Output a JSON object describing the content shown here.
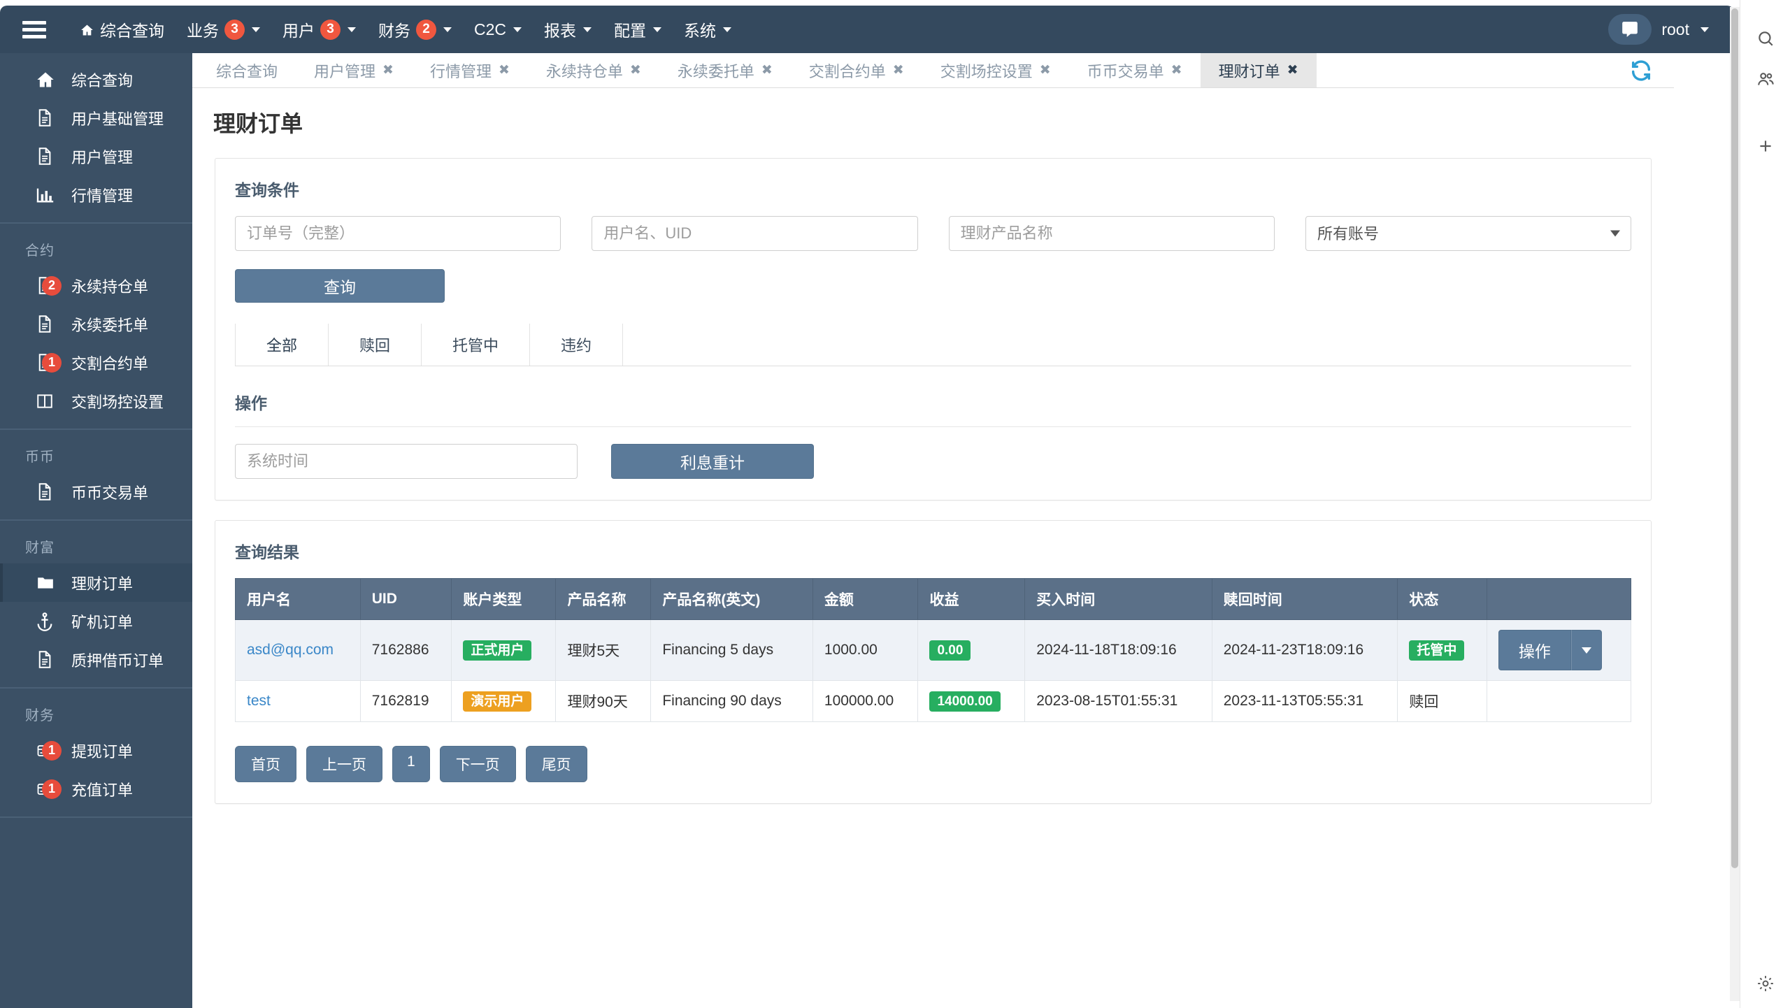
{
  "navbar": {
    "hamburger_icon": "hamburger-icon",
    "items": [
      {
        "label": "综合查询",
        "icon": "home-icon",
        "badge": null,
        "caret": false
      },
      {
        "label": "业务",
        "icon": null,
        "badge": "3",
        "caret": true
      },
      {
        "label": "用户",
        "icon": null,
        "badge": "3",
        "caret": true
      },
      {
        "label": "财务",
        "icon": null,
        "badge": "2",
        "caret": true
      },
      {
        "label": "C2C",
        "icon": null,
        "badge": null,
        "caret": true
      },
      {
        "label": "报表",
        "icon": null,
        "badge": null,
        "caret": true
      },
      {
        "label": "配置",
        "icon": null,
        "badge": null,
        "caret": true
      },
      {
        "label": "系统",
        "icon": null,
        "badge": null,
        "caret": true
      }
    ],
    "chat_icon": "chat-icon",
    "user": "root",
    "accent": "#f0573f",
    "background": "#34495e"
  },
  "sidebar": {
    "background": "#3b5065",
    "groups": [
      {
        "heading": null,
        "items": [
          {
            "label": "综合查询",
            "icon": "home-icon",
            "badge": null,
            "active": false
          },
          {
            "label": "用户基础管理",
            "icon": "document-icon",
            "badge": null,
            "active": false
          },
          {
            "label": "用户管理",
            "icon": "document-icon",
            "badge": null,
            "active": false
          },
          {
            "label": "行情管理",
            "icon": "chart-bar-icon",
            "badge": null,
            "active": false
          }
        ]
      },
      {
        "heading": "合约",
        "items": [
          {
            "label": "永续持仓单",
            "icon": "document-icon",
            "badge": "2",
            "active": false
          },
          {
            "label": "永续委托单",
            "icon": "document-icon",
            "badge": null,
            "active": false
          },
          {
            "label": "交割合约单",
            "icon": "document-icon",
            "badge": "1",
            "active": false
          },
          {
            "label": "交割场控设置",
            "icon": "columns-icon",
            "badge": null,
            "active": false
          }
        ]
      },
      {
        "heading": "币币",
        "items": [
          {
            "label": "币币交易单",
            "icon": "document-icon",
            "badge": null,
            "active": false
          }
        ]
      },
      {
        "heading": "财富",
        "items": [
          {
            "label": "理财订单",
            "icon": "folder-icon",
            "badge": null,
            "active": true
          },
          {
            "label": "矿机订单",
            "icon": "anchor-icon",
            "badge": null,
            "active": false
          },
          {
            "label": "质押借币订单",
            "icon": "document-icon",
            "badge": null,
            "active": false
          }
        ]
      },
      {
        "heading": "财务",
        "items": [
          {
            "label": "提现订单",
            "icon": "card-icon",
            "badge": "1",
            "active": false
          },
          {
            "label": "充值订单",
            "icon": "card-icon",
            "badge": "1",
            "active": false
          }
        ]
      }
    ]
  },
  "tabs": [
    {
      "label": "综合查询",
      "closable": false,
      "active": false
    },
    {
      "label": "用户管理",
      "closable": true,
      "active": false
    },
    {
      "label": "行情管理",
      "closable": true,
      "active": false
    },
    {
      "label": "永续持仓单",
      "closable": true,
      "active": false
    },
    {
      "label": "永续委托单",
      "closable": true,
      "active": false
    },
    {
      "label": "交割合约单",
      "closable": true,
      "active": false
    },
    {
      "label": "交割场控设置",
      "closable": true,
      "active": false
    },
    {
      "label": "币币交易单",
      "closable": true,
      "active": false
    },
    {
      "label": "理财订单",
      "closable": true,
      "active": true
    }
  ],
  "tab_close_glyph": "✖",
  "refresh_icon": "refresh-icon",
  "page": {
    "title": "理财订单"
  },
  "query": {
    "section_title": "查询条件",
    "order_no_placeholder": "订单号（完整）",
    "order_no_value": "",
    "user_placeholder": "用户名、UID",
    "user_value": "",
    "product_placeholder": "理财产品名称",
    "product_value": "",
    "account_selected": "所有账号",
    "account_options": [
      "所有账号"
    ],
    "query_button": "查询"
  },
  "status_tabs": [
    {
      "label": "全部",
      "active": true
    },
    {
      "label": "赎回",
      "active": false
    },
    {
      "label": "托管中",
      "active": false
    },
    {
      "label": "违约",
      "active": false
    }
  ],
  "operation": {
    "section_title": "操作",
    "systime_placeholder": "系统时间",
    "systime_value": "",
    "interest_button": "利息重计"
  },
  "results": {
    "section_title": "查询结果",
    "columns": [
      "用户名",
      "UID",
      "账户类型",
      "产品名称",
      "产品名称(英文)",
      "金额",
      "收益",
      "买入时间",
      "赎回时间",
      "状态",
      ""
    ],
    "rows": [
      {
        "username": "asd@qq.com",
        "uid": "7162886",
        "account_type": "正式用户",
        "account_type_color": "#27ae60",
        "product_name": "理财5天",
        "product_name_en": "Financing 5 days",
        "amount": "1000.00",
        "profit": "0.00",
        "profit_color": "#27ae60",
        "buy_time": "2024-11-18T18:09:16",
        "redeem_time": "2024-11-23T18:09:16",
        "status": "托管中",
        "status_color": "#27ae60",
        "status_is_pill": true,
        "action_label": "操作",
        "has_action": true
      },
      {
        "username": "test",
        "uid": "7162819",
        "account_type": "演示用户",
        "account_type_color": "#eda020",
        "product_name": "理财90天",
        "product_name_en": "Financing 90 days",
        "amount": "100000.00",
        "profit": "14000.00",
        "profit_color": "#27ae60",
        "buy_time": "2023-08-15T01:55:31",
        "redeem_time": "2023-11-13T05:55:31",
        "status": "赎回",
        "status_color": "",
        "status_is_pill": false,
        "action_label": "",
        "has_action": false
      }
    ]
  },
  "pager": {
    "first": "首页",
    "prev": "上一页",
    "current": "1",
    "next": "下一页",
    "last": "尾页"
  },
  "rail": {
    "search_icon": "search-icon",
    "people_icon": "people-icon",
    "plus_icon": "plus-icon",
    "gear_icon": "gear-icon"
  }
}
